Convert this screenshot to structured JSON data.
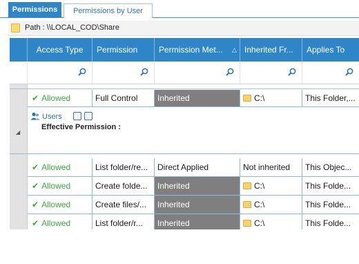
{
  "tabs": [
    {
      "label": "Permissions"
    },
    {
      "label": "Permissions by User"
    }
  ],
  "path": {
    "label": "Path : \\\\LOCAL_COD\\Share"
  },
  "columns": [
    {
      "label": "Access Type"
    },
    {
      "label": "Permission"
    },
    {
      "label": "Permission Met..."
    },
    {
      "label": "Inherited Fr..."
    },
    {
      "label": "Applies To"
    }
  ],
  "top_row": {
    "access": "Allowed",
    "permission": "Full Control",
    "method": "Inherited",
    "inherited_from": "C:\\",
    "applies_to": "This Folder,..."
  },
  "group": {
    "name": "Users",
    "effective_label": "Effective Permission :"
  },
  "rows": [
    {
      "access": "Allowed",
      "permission": "List folder/re...",
      "method": "Direct Applied",
      "inherited_from": "Not inherited",
      "applies_to": "This Objec..."
    },
    {
      "access": "Allowed",
      "permission": "Create folde...",
      "method": "Inherited",
      "inherited_from": "C:\\",
      "applies_to": "This Folde..."
    },
    {
      "access": "Allowed",
      "permission": "Create files/...",
      "method": "Inherited",
      "inherited_from": "C:\\",
      "applies_to": "This Folde..."
    },
    {
      "access": "Allowed",
      "permission": "List folder/r...",
      "method": "Inherited",
      "inherited_from": "C:\\",
      "applies_to": "This Folde..."
    }
  ],
  "colors": {
    "header_blue": "#2e86c8",
    "allowed_green": "#3caa3c",
    "inherited_gray": "#7f7f7f"
  }
}
